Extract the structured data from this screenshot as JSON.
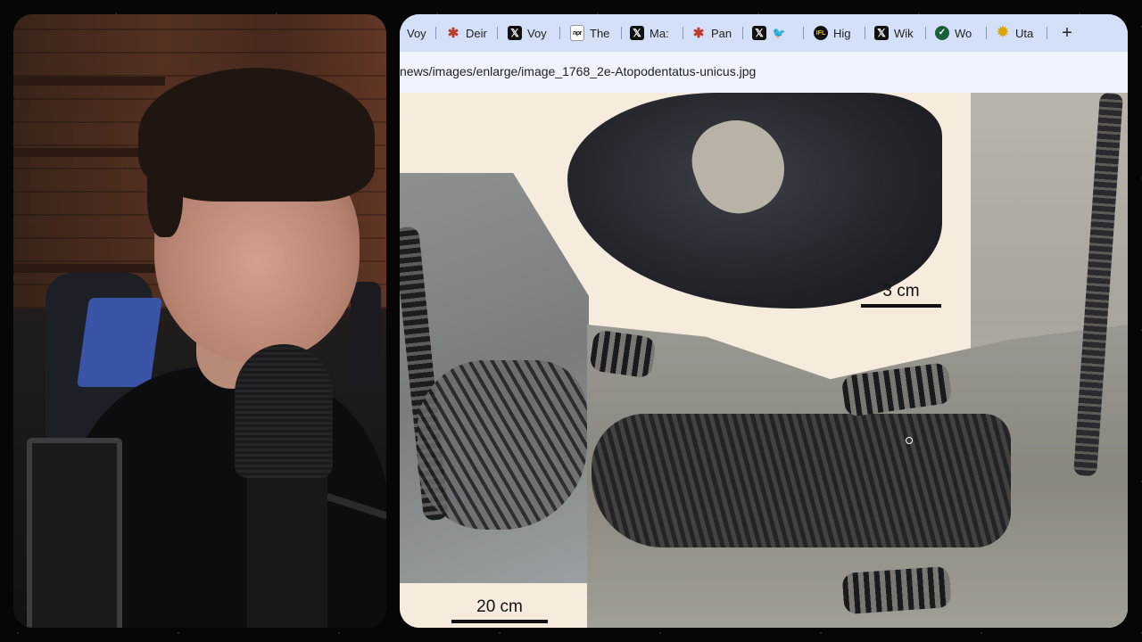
{
  "browser": {
    "tabs": [
      {
        "label": "Voy",
        "icon": "none"
      },
      {
        "label": "Deir",
        "icon": "red-star-icon"
      },
      {
        "label": "Voy",
        "icon": "x-logo-icon"
      },
      {
        "label": "The",
        "icon": "npr-logo-icon"
      },
      {
        "label": "Ma:",
        "icon": "x-logo-icon"
      },
      {
        "label": "Pan",
        "icon": "red-star-icon"
      },
      {
        "label": "",
        "icon": "x-logo-icon"
      },
      {
        "label": "",
        "icon": "bird-icon"
      },
      {
        "label": "Hig",
        "icon": "iflscience-logo-icon"
      },
      {
        "label": "Wik",
        "icon": "x-logo-icon"
      },
      {
        "label": "Wo",
        "icon": "science-logo-icon"
      },
      {
        "label": "Uta",
        "icon": "sun-logo-icon"
      }
    ],
    "new_tab_label": "+",
    "url": "news/images/enlarge/image_1768_2e-Atopodentatus-unicus.jpg"
  },
  "image": {
    "scale_top": "3 cm",
    "scale_bottom": "20 cm"
  },
  "colors": {
    "tab_strip": "#d3e0f7",
    "address_bar": "#eef3fc",
    "image_bg": "#f5ecdd"
  }
}
